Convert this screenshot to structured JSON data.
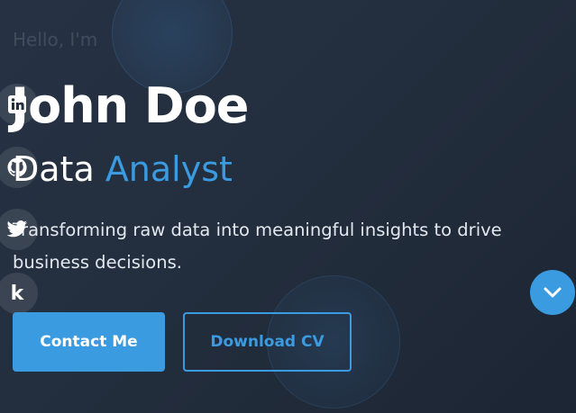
{
  "hero": {
    "greeting": "Hello, I'm",
    "name": "John Doe",
    "role_prefix": "Data ",
    "role_highlight": "Analyst",
    "tagline": "Transforming raw data into meaningful insights to drive business decisions."
  },
  "social": [
    {
      "icon": "linkedin-icon",
      "glyph": "in"
    },
    {
      "icon": "github-icon"
    },
    {
      "icon": "twitter-icon"
    },
    {
      "icon": "kaggle-icon",
      "glyph": "k"
    }
  ],
  "buttons": {
    "contact_label": "Contact Me",
    "download_label": "Download CV"
  },
  "scroll": {
    "icon": "chevron-down-icon"
  },
  "colors": {
    "accent": "#3b9be0",
    "background": "#232e3d",
    "text": "#ffffff"
  }
}
